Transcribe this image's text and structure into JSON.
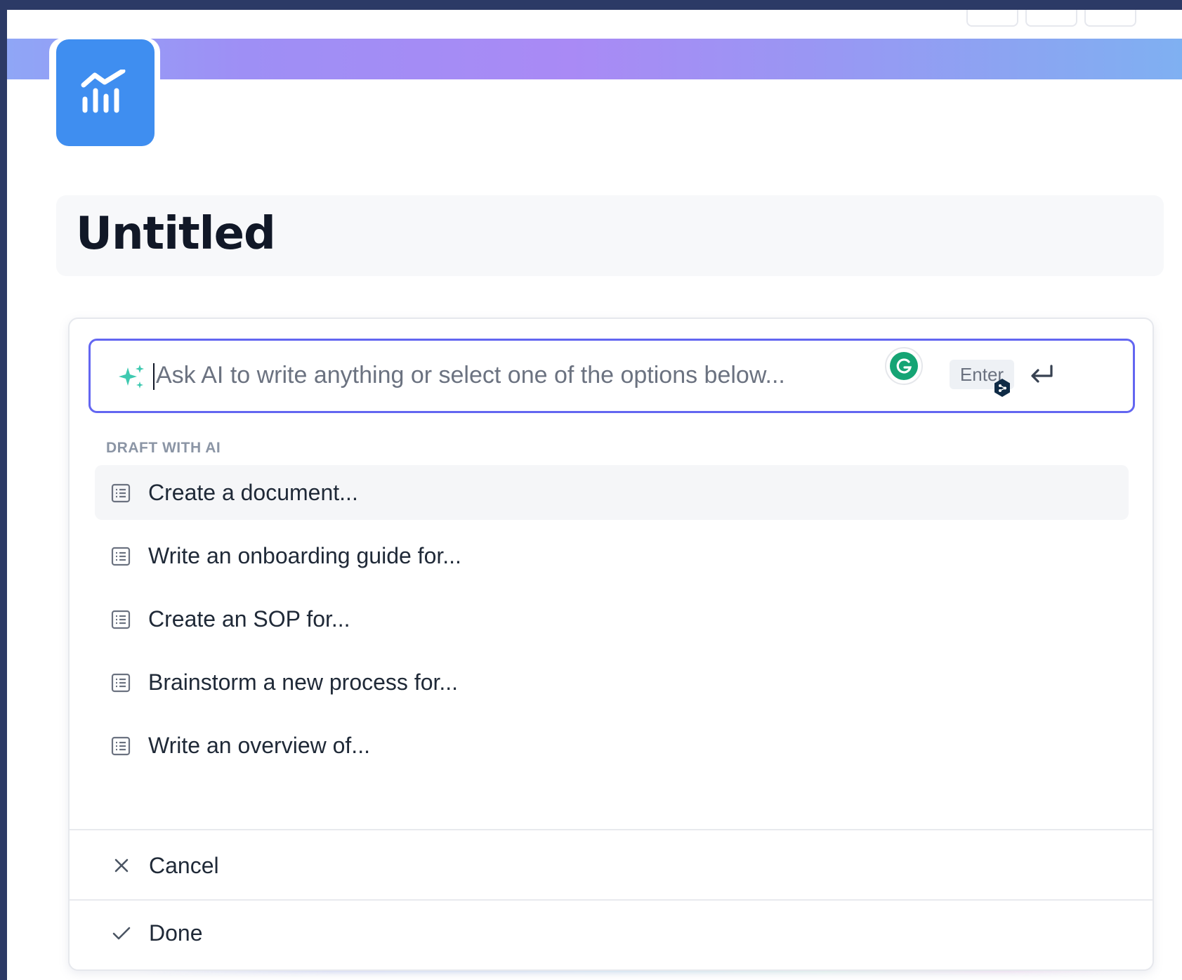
{
  "page": {
    "title": "Untitled",
    "icon": "chart-trend-icon",
    "banner_colors": [
      "#8fa6f6",
      "#a98af5",
      "#7fb0f2"
    ]
  },
  "ai_prompt": {
    "placeholder": "Ask AI to write anything or select one of the options below...",
    "value": "",
    "enter_label": "Enter",
    "accent_color": "#6366f1"
  },
  "section": {
    "label": "DRAFT WITH AI"
  },
  "options": [
    {
      "label": "Create a document...",
      "icon": "document-list-icon"
    },
    {
      "label": "Write an onboarding guide for...",
      "icon": "document-list-icon"
    },
    {
      "label": "Create an SOP for...",
      "icon": "document-list-icon"
    },
    {
      "label": "Brainstorm a new process for...",
      "icon": "document-list-icon"
    },
    {
      "label": "Write an overview of...",
      "icon": "document-list-icon"
    }
  ],
  "footer": {
    "cancel_label": "Cancel",
    "done_label": "Done"
  }
}
